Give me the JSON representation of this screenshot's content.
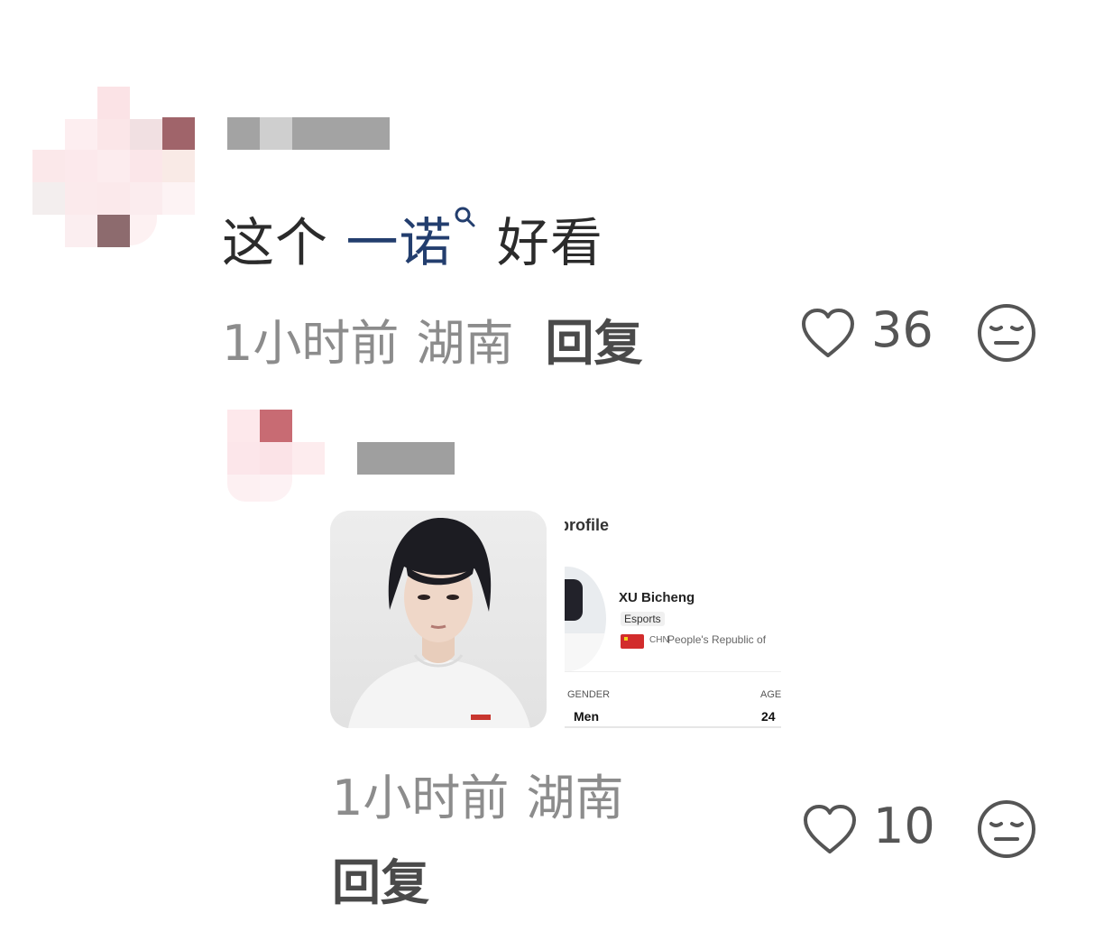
{
  "comment": {
    "text_before": "这个",
    "link_text": "一诺",
    "text_after": "好看",
    "time": "1小时前",
    "location": "湖南",
    "reply_label": "回复",
    "like_count": "36",
    "like_icon": "heart-outline-icon",
    "dislike_icon": "neutral-face-icon"
  },
  "reply": {
    "profile_card": {
      "heading": "profile",
      "name": "XU Bicheng",
      "sport": "Esports",
      "country_code": "CHN",
      "country": "People's Republic of",
      "gender_label": "GENDER",
      "gender_value": "Men",
      "age_label": "AGE",
      "age_value": "24"
    },
    "time": "1小时前",
    "location": "湖南",
    "reply_label": "回复",
    "like_count": "10",
    "like_icon": "heart-outline-icon",
    "dislike_icon": "neutral-face-icon"
  },
  "colors": {
    "link": "#233e6e",
    "meta": "#8c8c8c"
  }
}
